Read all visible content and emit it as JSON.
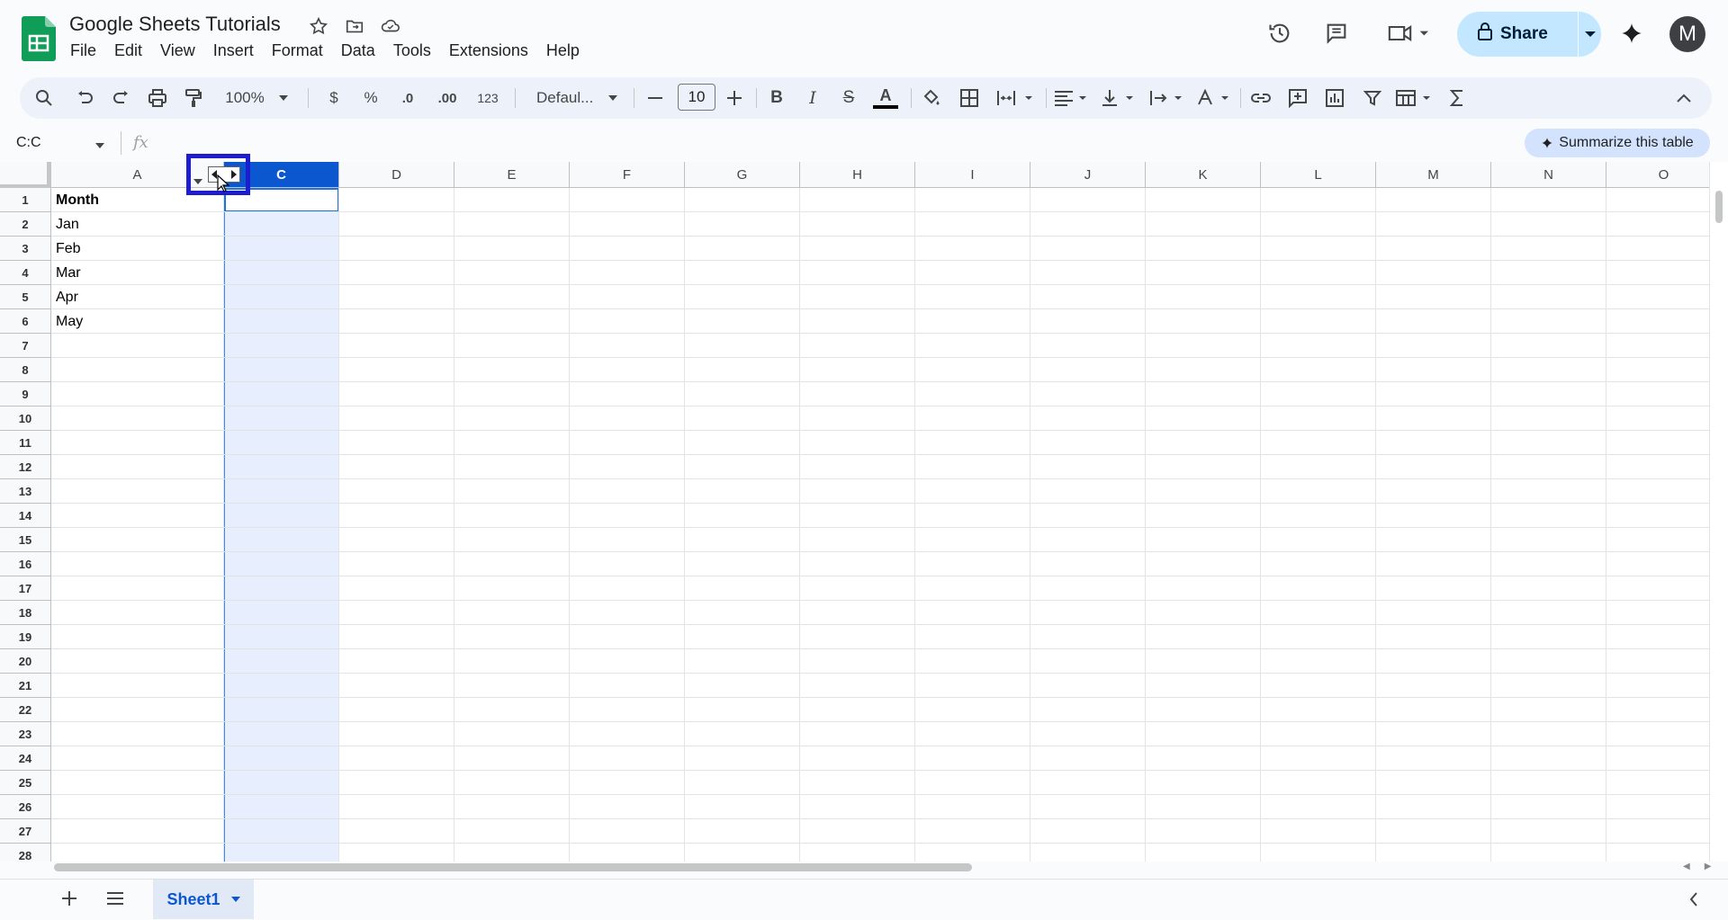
{
  "app": {
    "document_title": "Google Sheets Tutorials",
    "avatar_letter": "M"
  },
  "menu": {
    "items": [
      "File",
      "Edit",
      "View",
      "Insert",
      "Format",
      "Data",
      "Tools",
      "Extensions",
      "Help"
    ]
  },
  "header": {
    "share_label": "Share"
  },
  "toolbar": {
    "zoom": "100%",
    "currency": "$",
    "percent": "%",
    "decrease_decimal": ".0",
    "increase_decimal": ".00",
    "number_format": "123",
    "font_family": "Defaul...",
    "font_size": "10",
    "bold": "B",
    "italic": "I",
    "strikethrough": "S",
    "text_color": "A"
  },
  "formula_bar": {
    "name_box": "C:C",
    "fx_label": "fx",
    "summarize_label": "Summarize this table"
  },
  "grid": {
    "columns": [
      "A",
      "C",
      "D",
      "E",
      "F",
      "G",
      "H",
      "I",
      "J",
      "K",
      "L",
      "M",
      "N",
      "O"
    ],
    "selected_column": "C",
    "rows": [
      "1",
      "2",
      "3",
      "4",
      "5",
      "6",
      "7",
      "8",
      "9",
      "10",
      "11",
      "12",
      "13",
      "14",
      "15",
      "16",
      "17",
      "18",
      "19",
      "20",
      "21",
      "22",
      "23",
      "24",
      "25",
      "26",
      "27",
      "28"
    ],
    "column_a_values": [
      "Month",
      "Jan",
      "Feb",
      "Mar",
      "Apr",
      "May"
    ]
  },
  "sheets": {
    "active_tab": "Sheet1"
  },
  "colors": {
    "brand_green": "#0f9d58",
    "selection_blue": "#0b57d0",
    "share_bg": "#c2e7ff",
    "highlight_box": "#1d1ccf"
  }
}
